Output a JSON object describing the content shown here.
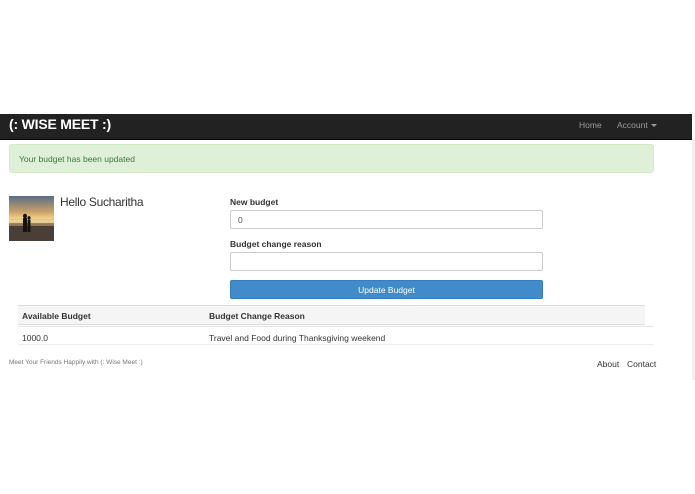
{
  "navbar": {
    "brand": "(: WISE MEET :)",
    "home": "Home",
    "account": "Account"
  },
  "alert": {
    "message": "Your budget has been updated"
  },
  "profile": {
    "greeting": "Hello Sucharitha"
  },
  "form": {
    "new_budget_label": "New budget",
    "new_budget_value": "0",
    "reason_label": "Budget change reason",
    "reason_value": "",
    "submit_label": "Update Budget"
  },
  "table": {
    "headers": [
      "Available Budget",
      "Budget Change Reason"
    ],
    "rows": [
      [
        "1000.0",
        "Travel and Food during Thanksgiving weekend"
      ]
    ]
  },
  "footer": {
    "tagline": "Meet Your Friends Happily with (: Wise Meet :)",
    "about": "About",
    "contact": "Contact"
  },
  "colors": {
    "navbar_bg": "#222222",
    "alert_bg": "#dff0d8",
    "alert_text": "#3c763d",
    "primary": "#428bca"
  }
}
